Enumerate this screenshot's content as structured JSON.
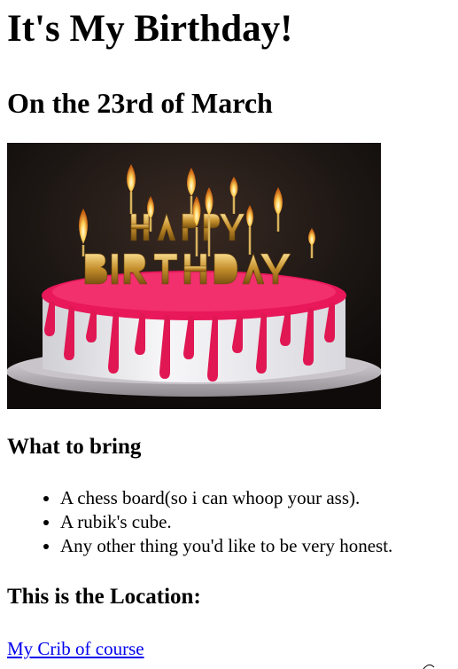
{
  "header": {
    "title": "It's My Birthday!",
    "date_heading": "On the 23rd of March"
  },
  "image": {
    "cake_icon": "birthday-cake-with-candles",
    "candle_text": "HAPPY BIRTHDAY"
  },
  "bring": {
    "heading": "What to bring",
    "items": [
      "A chess board(so i can whoop your ass).",
      "A rubik's cube.",
      "Any other thing you'd like to be very honest."
    ]
  },
  "location": {
    "heading": "This is the Location:",
    "link_text": "My Crib of course"
  },
  "colors": {
    "link": "#0000ee",
    "frosting": "#e8185a",
    "background": "#1a1515"
  }
}
